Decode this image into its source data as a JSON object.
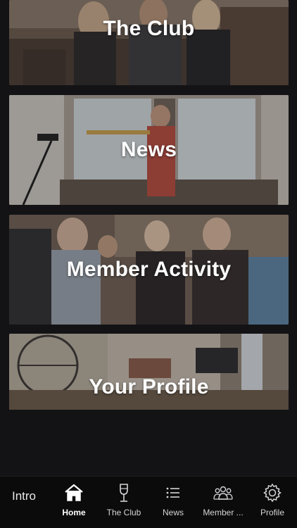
{
  "cards": [
    {
      "title": "The Club"
    },
    {
      "title": "News"
    },
    {
      "title": "Member Activity"
    },
    {
      "title": "Your Profile"
    }
  ],
  "tabbar": {
    "intro_label": "Intro",
    "tabs": [
      {
        "label": "Home",
        "icon": "home-icon",
        "active": true
      },
      {
        "label": "The Club",
        "icon": "wine-glass-icon",
        "active": false
      },
      {
        "label": "News",
        "icon": "list-icon",
        "active": false
      },
      {
        "label": "Member ...",
        "icon": "people-group-icon",
        "active": false
      },
      {
        "label": "Profile",
        "icon": "gear-icon",
        "active": false
      }
    ]
  },
  "colors": {
    "background": "#131315",
    "tabbar": "#0b0b0c",
    "text": "#ffffff"
  }
}
